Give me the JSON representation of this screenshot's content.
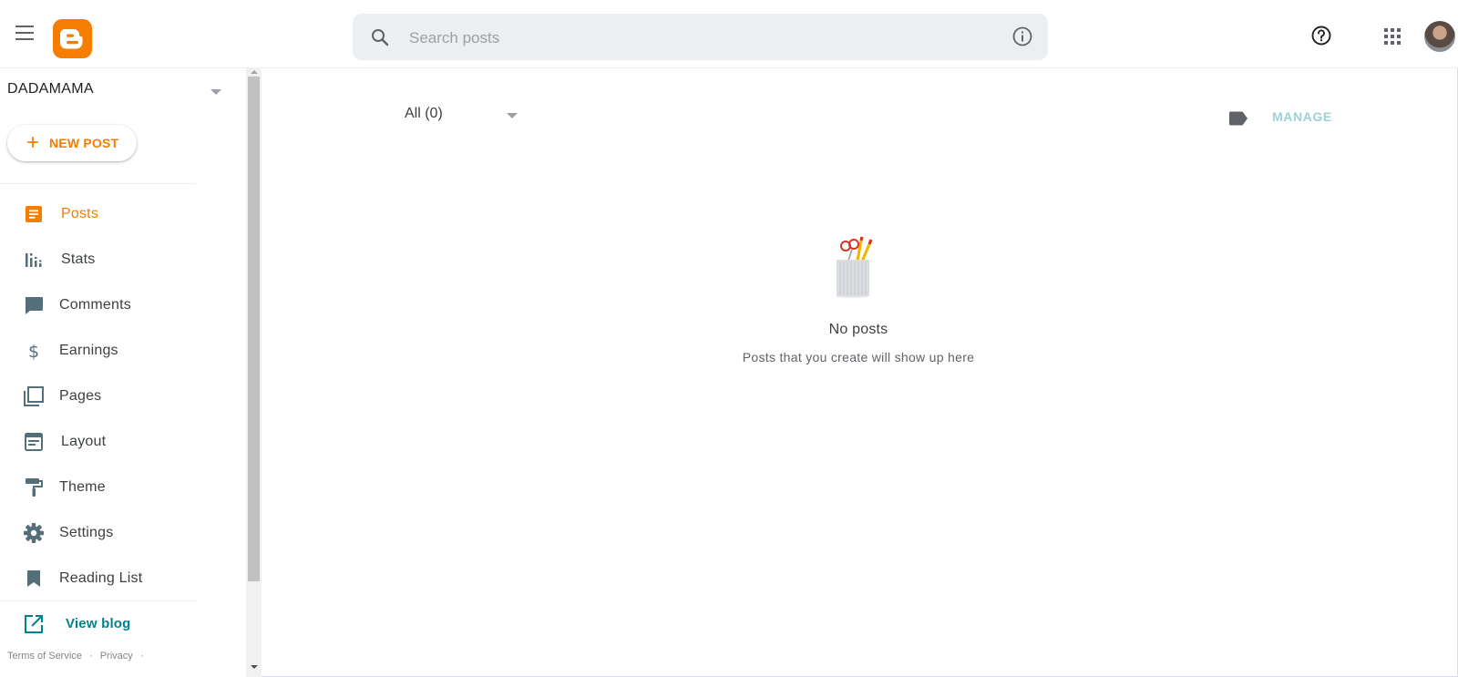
{
  "header": {
    "search": {
      "placeholder": "Search posts"
    },
    "icons": [
      "menu-icon",
      "blogger-logo",
      "search-icon",
      "info-icon",
      "help-icon",
      "apps-icon",
      "avatar"
    ]
  },
  "sidebar": {
    "blog_name": "DADAMAMA",
    "new_post_label": "NEW POST",
    "items": [
      {
        "label": "Posts",
        "icon": "posts-icon",
        "active": true
      },
      {
        "label": "Stats",
        "icon": "stats-icon"
      },
      {
        "label": "Comments",
        "icon": "comments-icon"
      },
      {
        "label": "Earnings",
        "icon": "dollar-icon"
      },
      {
        "label": "Pages",
        "icon": "pages-icon"
      },
      {
        "label": "Layout",
        "icon": "layout-icon"
      },
      {
        "label": "Theme",
        "icon": "paint-roller-icon"
      },
      {
        "label": "Settings",
        "icon": "gear-icon"
      },
      {
        "label": "Reading List",
        "icon": "bookmark-icon"
      }
    ],
    "view_blog_label": "View blog",
    "footer": {
      "terms": "Terms of Service",
      "sep": "·",
      "privacy": "Privacy",
      "sep2": "·"
    }
  },
  "main": {
    "filter_label": "All (0)",
    "manage_label": "MANAGE",
    "empty_title": "No posts",
    "empty_subtitle": "Posts that you create will show up here"
  },
  "colors": {
    "accent": "#f57d00",
    "teal": "#00838f",
    "manage": "#9fd1d6",
    "icon_gray": "#5f6368",
    "nav_icon": "#546e7a"
  }
}
